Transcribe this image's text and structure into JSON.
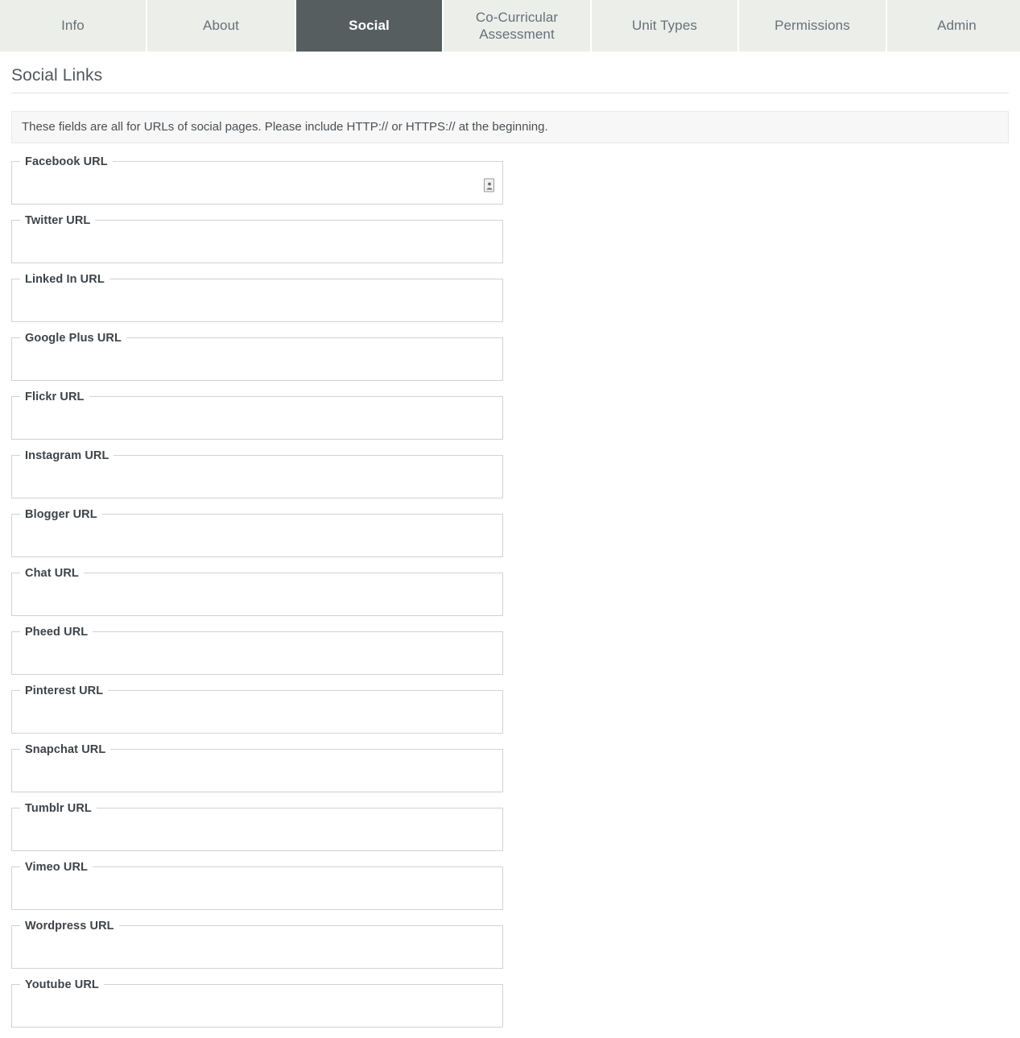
{
  "tabs": [
    {
      "label": "Info",
      "active": false,
      "key": "info"
    },
    {
      "label": "About",
      "active": false,
      "key": "about"
    },
    {
      "label": "Social",
      "active": true,
      "key": "social"
    },
    {
      "label": "Co-Curricular Assessment",
      "active": false,
      "key": "co-curricular-assessment"
    },
    {
      "label": "Unit Types",
      "active": false,
      "key": "unit-types"
    },
    {
      "label": "Permissions",
      "active": false,
      "key": "permissions"
    },
    {
      "label": "Admin",
      "active": false,
      "key": "admin"
    }
  ],
  "page": {
    "title": "Social Links",
    "notice": "These fields are all for URLs of social pages. Please include HTTP:// or HTTPS:// at the beginning."
  },
  "fields": [
    {
      "label": "Facebook URL",
      "value": "",
      "placeholder": "",
      "has_autofill_icon": true
    },
    {
      "label": "Twitter URL",
      "value": "",
      "placeholder": "",
      "has_autofill_icon": false
    },
    {
      "label": "Linked In URL",
      "value": "",
      "placeholder": "",
      "has_autofill_icon": false
    },
    {
      "label": "Google Plus URL",
      "value": "",
      "placeholder": "",
      "has_autofill_icon": false
    },
    {
      "label": "Flickr URL",
      "value": "",
      "placeholder": "",
      "has_autofill_icon": false
    },
    {
      "label": "Instagram URL",
      "value": "",
      "placeholder": "",
      "has_autofill_icon": false
    },
    {
      "label": "Blogger URL",
      "value": "",
      "placeholder": "",
      "has_autofill_icon": false
    },
    {
      "label": "Chat URL",
      "value": "",
      "placeholder": "",
      "has_autofill_icon": false
    },
    {
      "label": "Pheed URL",
      "value": "",
      "placeholder": "",
      "has_autofill_icon": false
    },
    {
      "label": "Pinterest URL",
      "value": "",
      "placeholder": "",
      "has_autofill_icon": false
    },
    {
      "label": "Snapchat URL",
      "value": "",
      "placeholder": "",
      "has_autofill_icon": false
    },
    {
      "label": "Tumblr URL",
      "value": "",
      "placeholder": "",
      "has_autofill_icon": false
    },
    {
      "label": "Vimeo URL",
      "value": "",
      "placeholder": "",
      "has_autofill_icon": false
    },
    {
      "label": "Wordpress URL",
      "value": "",
      "placeholder": "",
      "has_autofill_icon": false
    },
    {
      "label": "Youtube URL",
      "value": "",
      "placeholder": "",
      "has_autofill_icon": false
    }
  ],
  "icons": {
    "autofill": "autofill-contact-card-icon"
  },
  "colors": {
    "active_tab_bg": "#565e60",
    "inactive_tab_bg": "#eceeea",
    "notice_bg": "#f7f7f7",
    "field_border": "#d2d2d2",
    "text": "#3a3f42"
  }
}
